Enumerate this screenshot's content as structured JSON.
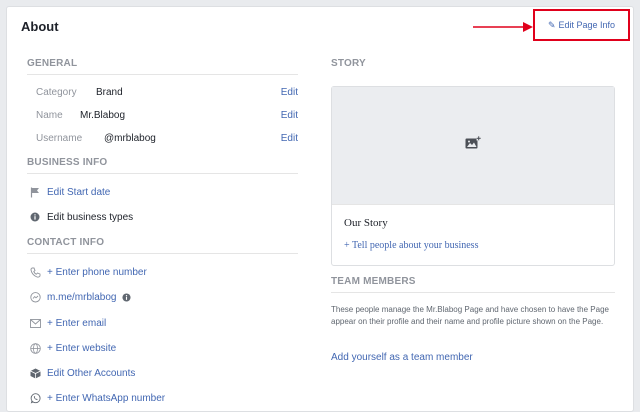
{
  "header": {
    "title": "About",
    "edit_page_info": "Edit Page Info",
    "accent_color": "#e0001b"
  },
  "general": {
    "heading": "GENERAL",
    "rows": [
      {
        "label": "Category",
        "value": "Brand",
        "action": "Edit"
      },
      {
        "label": "Name",
        "value": "Mr.Blabog",
        "action": "Edit"
      },
      {
        "label": "Username",
        "value": "@mrblabog",
        "action": "Edit"
      }
    ]
  },
  "business_info": {
    "heading": "BUSINESS INFO",
    "start_date": "Edit Start date",
    "business_types": "Edit business types"
  },
  "contact_info": {
    "heading": "CONTACT INFO",
    "phone": "+ Enter phone number",
    "messenger": "m.me/mrblabog",
    "email": "+ Enter email",
    "website": "+ Enter website",
    "other_accounts": "Edit Other Accounts",
    "whatsapp": "+ Enter WhatsApp number"
  },
  "story": {
    "heading": "STORY",
    "title": "Our Story",
    "link": "+ Tell people about your business"
  },
  "team": {
    "heading": "TEAM MEMBERS",
    "description": "These people manage the Mr.Blabog Page and have chosen to have the Page appear on their profile and their name and profile picture shown on the Page.",
    "add_link": "Add yourself as a team member"
  }
}
